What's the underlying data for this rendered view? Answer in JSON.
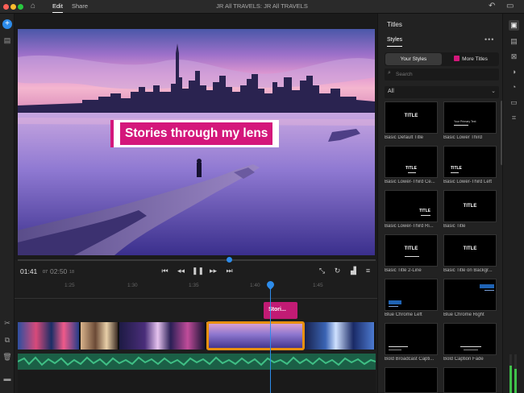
{
  "app": {
    "window_title": "JR All TRAVELS: JR All TRAVELS",
    "menu": {
      "edit": "Edit",
      "share": "Share"
    }
  },
  "viewer": {
    "title_overlay_text": "Stories through my lens",
    "current_time": "01:41",
    "current_frames": "07",
    "total_time": "02:50",
    "total_frames": "18",
    "scrub_progress": 0.59
  },
  "timeline": {
    "ticks": [
      "1:25",
      "1:30",
      "1:35",
      "1:40",
      "1:45"
    ],
    "title_clip_label": "Stori..."
  },
  "titles_panel": {
    "heading": "Titles",
    "tab_styles": "Styles",
    "seg_your_styles": "Your Styles",
    "seg_more_titles": "More Titles",
    "search_placeholder": "Search",
    "filter_value": "All",
    "tiles": [
      {
        "label": "Basic Default Title",
        "thumb_text": "TITLE"
      },
      {
        "label": "Basic Lower Third",
        "thumb_text": "Your Primary Text"
      },
      {
        "label": "Basic Lower-Third Ce...",
        "thumb_text": "TITLE"
      },
      {
        "label": "Basic Lower-Third Left",
        "thumb_text": "TITLE"
      },
      {
        "label": "Basic Lower-Third Ri...",
        "thumb_text": "TITLE"
      },
      {
        "label": "Basic Title",
        "thumb_text": "TITLE"
      },
      {
        "label": "Basic Title 2-Line",
        "thumb_text": "TITLE"
      },
      {
        "label": "Basic Title on Backgr...",
        "thumb_text": "TITLE"
      },
      {
        "label": "Blue Chrome Left",
        "thumb_text": ""
      },
      {
        "label": "Blue Chrome Right",
        "thumb_text": ""
      },
      {
        "label": "Bold Broadcast Capti...",
        "thumb_text": ""
      },
      {
        "label": "Bold Caption Fade",
        "thumb_text": ""
      }
    ]
  },
  "audio_meter": {
    "left_level": 0.7,
    "right_level": 0.62
  },
  "colors": {
    "accent_blue": "#2d8ceb",
    "title_pink": "#d4177b",
    "selected_clip_orange": "#e8900f",
    "audio_green": "#1b5f46"
  },
  "icons": {
    "home": "home-icon",
    "undo": "undo-icon",
    "chat": "chat-icon"
  }
}
